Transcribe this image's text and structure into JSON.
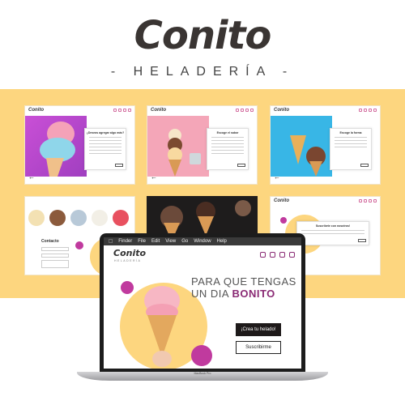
{
  "brand": {
    "logo": "Conito",
    "subtitle": "- HELADERÍA -"
  },
  "card_screens": {
    "logo": "Conito",
    "screen1_title": "¿Deseas agregar algo más?",
    "screen2_title": "Escoge el sabor",
    "screen3_title": "Escoge la forma",
    "screen5_title": "Contacto",
    "screen6_title": "Suscríbete con nosotros!"
  },
  "laptop": {
    "menu": [
      "Finder",
      "File",
      "Edit",
      "View",
      "Go",
      "Window",
      "Help"
    ],
    "logo": "Conito",
    "logo_sub": "HELADERÍA",
    "headline_line1": "PARA QUE TENGAS",
    "headline_line2_prefix": "UN DIA",
    "headline_line2_emphasis": "BONITO",
    "cta_primary": "¡Crea tu helado!",
    "cta_secondary": "Suscribirme",
    "model_label": "MacBook Pro"
  },
  "colors": {
    "accent": "#c03a9e",
    "yellow": "#fdd67f",
    "plum": "#8a2a74"
  }
}
